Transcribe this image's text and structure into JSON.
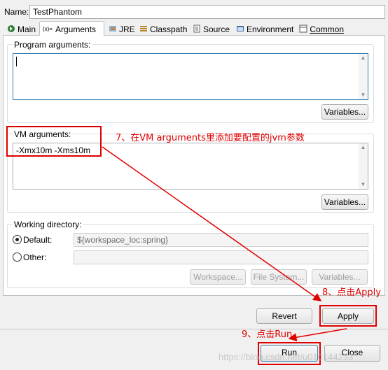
{
  "name_field": {
    "label": "Name:",
    "value": "TestPhantom"
  },
  "tabs": [
    {
      "label": "Main",
      "icon": "main-icon"
    },
    {
      "label": "Arguments",
      "icon": "arguments-icon"
    },
    {
      "label": "JRE",
      "icon": "jre-icon"
    },
    {
      "label": "Classpath",
      "icon": "classpath-icon"
    },
    {
      "label": "Source",
      "icon": "source-icon"
    },
    {
      "label": "Environment",
      "icon": "environment-icon"
    },
    {
      "label": "Common",
      "icon": "common-icon"
    }
  ],
  "program_args": {
    "label": "Program arguments:",
    "value": "",
    "variables_label": "Variables..."
  },
  "vm_args": {
    "label": "VM arguments:",
    "value": "-Xmx10m -Xms10m",
    "variables_label": "Variables..."
  },
  "working_dir": {
    "label": "Working directory:",
    "default_label": "Default:",
    "default_value": "${workspace_loc:spring}",
    "other_label": "Other:",
    "other_value": "",
    "workspace_label": "Workspace...",
    "filesystem_label": "File System...",
    "variables_label": "Variables..."
  },
  "buttons": {
    "revert": "Revert",
    "apply": "Apply",
    "run": "Run",
    "close": "Close"
  },
  "annotations": {
    "step7": "7、在VM arguments里添加要配置的jvm参数",
    "step8": "8、点击Apply",
    "step9": "9、点击Run"
  },
  "watermark": "https://blog.csdn.net/u010144233",
  "colors": {
    "annotation_red": "#e00000",
    "active_tab": "#ffffff",
    "focus_blue": "#3c7fb1"
  }
}
